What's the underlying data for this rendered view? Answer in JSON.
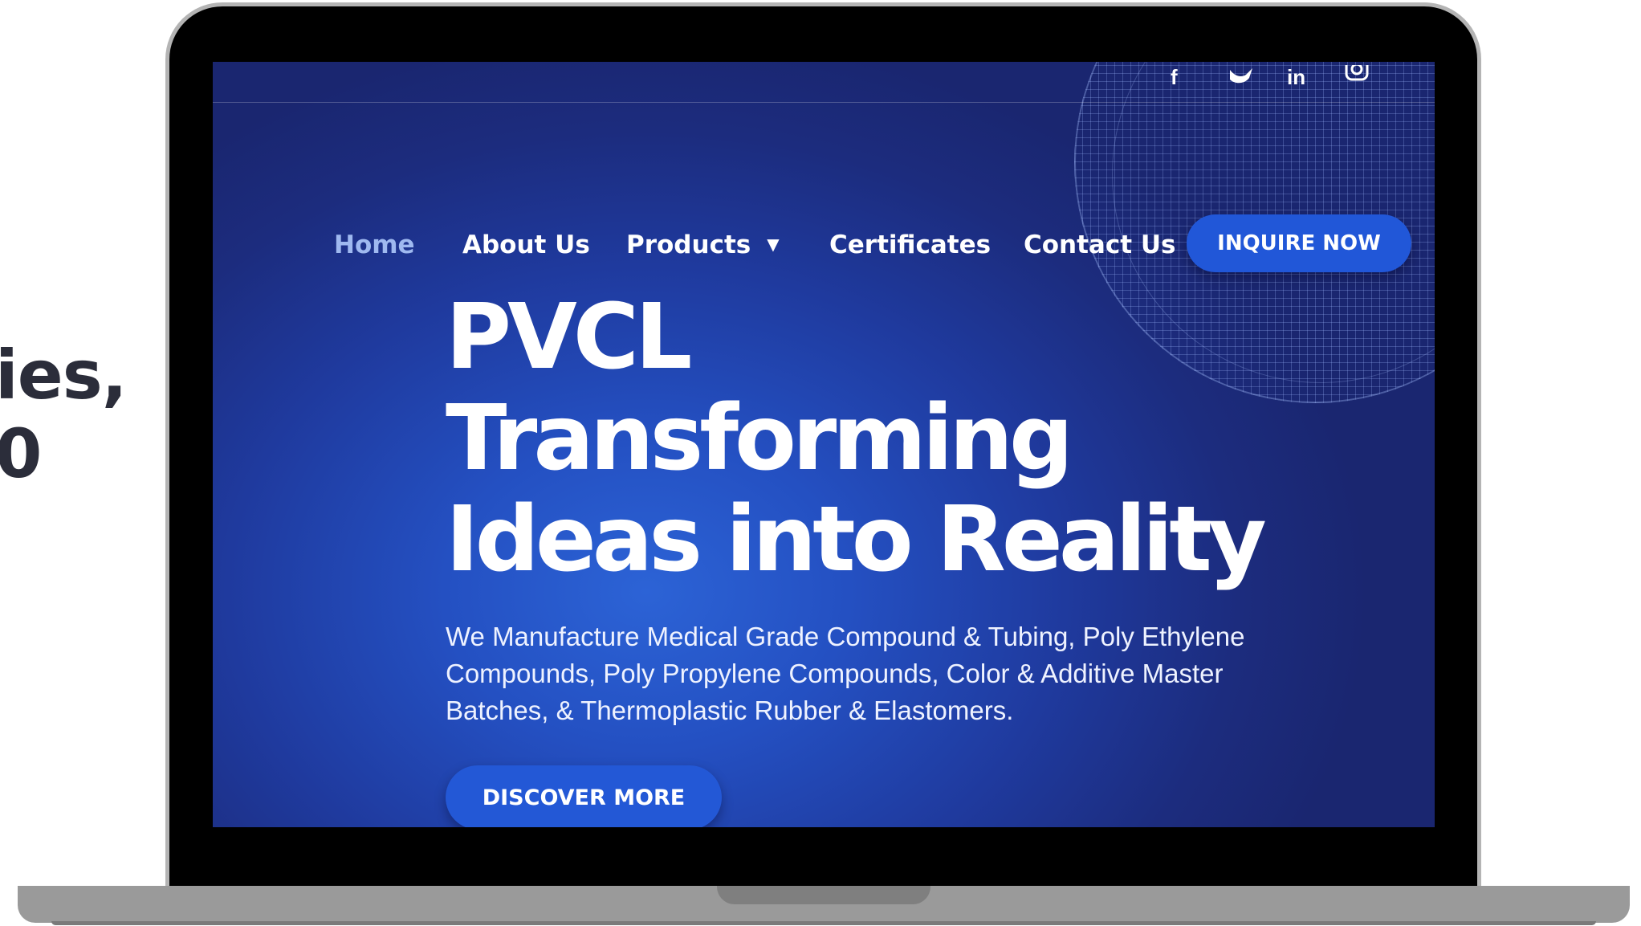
{
  "side_text": {
    "line1": "ies,",
    "line2": "0"
  },
  "social_icons": [
    "facebook-icon",
    "twitter-icon",
    "linkedin-icon",
    "instagram-icon"
  ],
  "nav": {
    "home": "Home",
    "about": "About Us",
    "products": "Products",
    "certificates": "Certificates",
    "contact": "Contact Us",
    "inquire": "INQUIRE NOW"
  },
  "hero": {
    "title_line1": "PVCL",
    "title_line2": "Transforming",
    "title_line3": "Ideas into Reality",
    "description_line1": "We Manufacture Medical Grade Compound & Tubing, Poly Ethylene",
    "description_line2": "Compounds, Poly Propylene Compounds, Color & Additive Master",
    "description_line3": "Batches, & Thermoplastic Rubber & Elastomers.",
    "cta": "DISCOVER MORE"
  },
  "colors": {
    "background_primary": "#1f3a9e",
    "accent": "#2157d8",
    "active_nav": "#9fb9f0"
  }
}
